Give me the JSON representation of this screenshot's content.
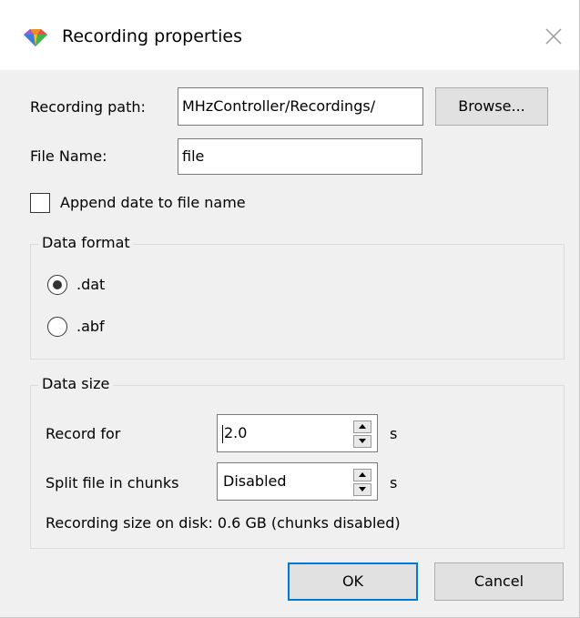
{
  "window": {
    "title": "Recording properties",
    "icon": "app-diamond-icon",
    "close_icon": "close-icon"
  },
  "path": {
    "label": "Recording path:",
    "value": "MHzController/Recordings/",
    "browse_label": "Browse..."
  },
  "file": {
    "label": "File Name:",
    "value": "file"
  },
  "append_date": {
    "label": "Append date to file name",
    "checked": false
  },
  "data_format": {
    "title": "Data format",
    "options": [
      {
        "label": ".dat",
        "selected": true
      },
      {
        "label": ".abf",
        "selected": false
      }
    ]
  },
  "data_size": {
    "title": "Data size",
    "record_for": {
      "label": "Record for",
      "value": "2.0",
      "unit": "s"
    },
    "split": {
      "label": "Split file in chunks",
      "value": "Disabled",
      "unit": "s"
    },
    "size_info": "Recording size on disk: 0.6 GB (chunks disabled)"
  },
  "buttons": {
    "ok": "OK",
    "cancel": "Cancel"
  },
  "colors": {
    "accent": "#0078d7",
    "dialog_bg": "#f0f0f0"
  }
}
